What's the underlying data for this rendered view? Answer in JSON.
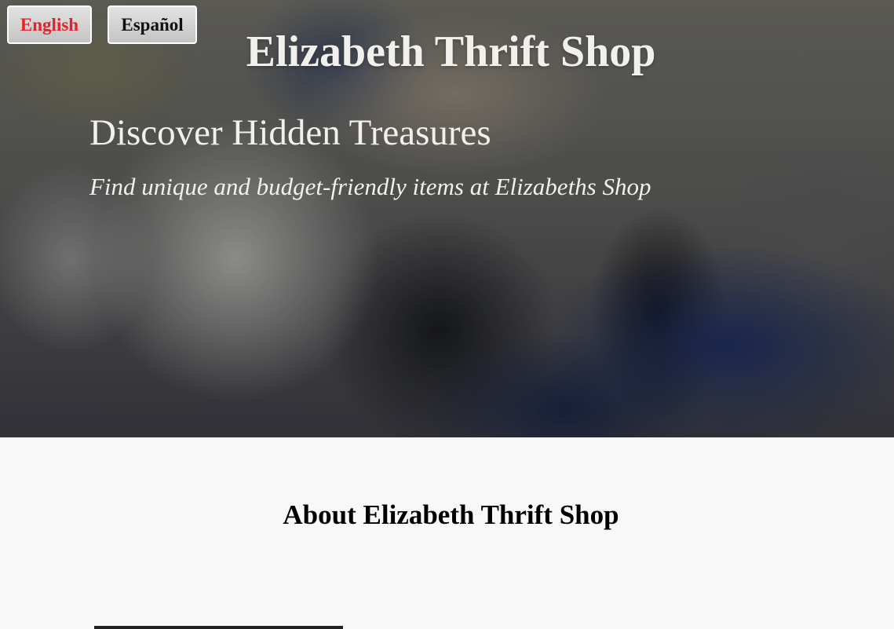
{
  "language_switch": {
    "english_label": "English",
    "spanish_label": "Español"
  },
  "hero": {
    "site_title": "Elizabeth Thrift Shop",
    "heading": "Discover Hidden Treasures",
    "subheading": "Find unique and budget-friendly items at Elizabeths Shop"
  },
  "about": {
    "title": "About Elizabeth Thrift Shop"
  },
  "colors": {
    "active_language": "#e8202a",
    "hero_text": "#f2f0ec",
    "page_background": "#f8f8f8"
  }
}
